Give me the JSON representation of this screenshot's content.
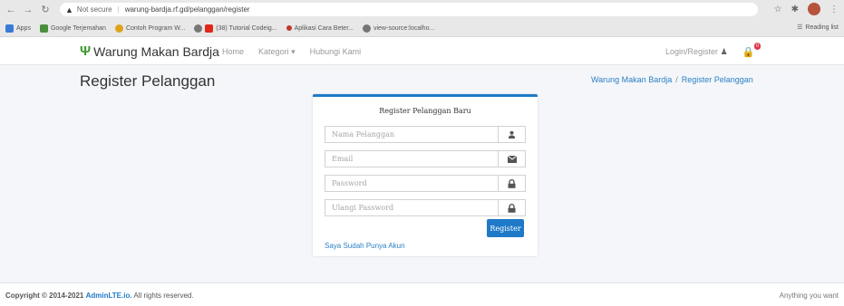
{
  "browser": {
    "security_label": "Not secure",
    "url": "warung-bardja.rf.gd/pelanggan/register",
    "bookmarks": [
      "Apps",
      "Google Terjemahan",
      "Contoh Program W...",
      "(38) Tutorial Codeig...",
      "Aplikasi Cara Beter...",
      "view-source:localho..."
    ],
    "reading_list": "Reading list"
  },
  "navbar": {
    "brand": "Warung Makan Bardja",
    "links": [
      "Home",
      "Kategori",
      "Hubungi Kami"
    ],
    "login_register": "Login/Register",
    "cart_badge": "0"
  },
  "page": {
    "title": "Register Pelanggan",
    "breadcrumb": [
      "Warung Makan Bardja",
      "Register Pelanggan"
    ]
  },
  "form": {
    "title": "Register Pelanggan Baru",
    "fields": [
      {
        "placeholder": "Nama Pelanggan",
        "icon": "user-icon"
      },
      {
        "placeholder": "Email",
        "icon": "envelope-icon"
      },
      {
        "placeholder": "Password",
        "icon": "lock-icon"
      },
      {
        "placeholder": "Ulangi Password",
        "icon": "lock-icon"
      }
    ],
    "submit_label": "Register",
    "login_link": "Saya Sudah Punya Akun"
  },
  "footer": {
    "copyright_prefix": "Copyright © 2014-2021",
    "brand_link": "AdminLTE.io.",
    "copyright_suffix": "All rights reserved.",
    "right_text": "Anything you want"
  }
}
